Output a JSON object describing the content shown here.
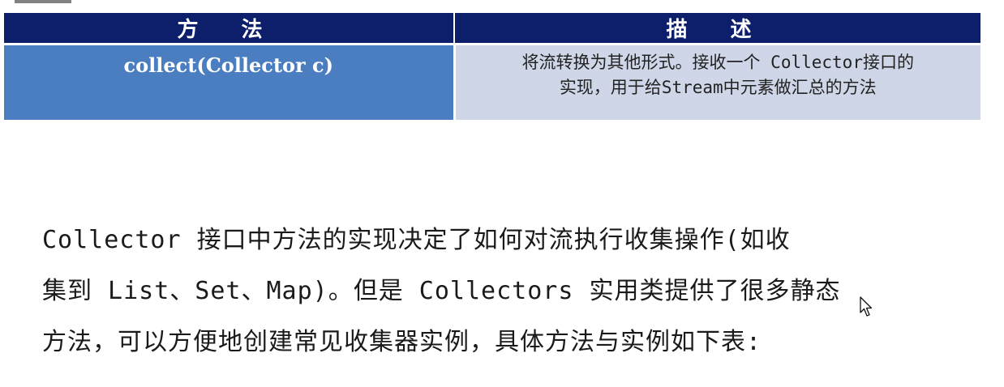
{
  "table": {
    "headers": [
      "方 法",
      "描 述"
    ],
    "rows": [
      {
        "method": "collect(Collector c)",
        "description_line1": "将流转换为其他形式。接收一个 Collector接口的",
        "description_line2": "实现，用于给Stream中元素做汇总的方法"
      }
    ],
    "colors": {
      "header_bg": "#0d1f6b",
      "method_bg": "#4a7ec0",
      "desc_bg": "#cfd6e8"
    }
  },
  "paragraph": {
    "line1": "Collector 接口中方法的实现决定了如何对流执行收集操作(如收",
    "line2": "集到 List、Set、Map)。但是 Collectors 实用类提供了很多静态",
    "line3": "方法，可以方便地创建常见收集器实例，具体方法与实例如下表:"
  },
  "icons": {
    "cursor": "mouse-pointer-icon"
  }
}
